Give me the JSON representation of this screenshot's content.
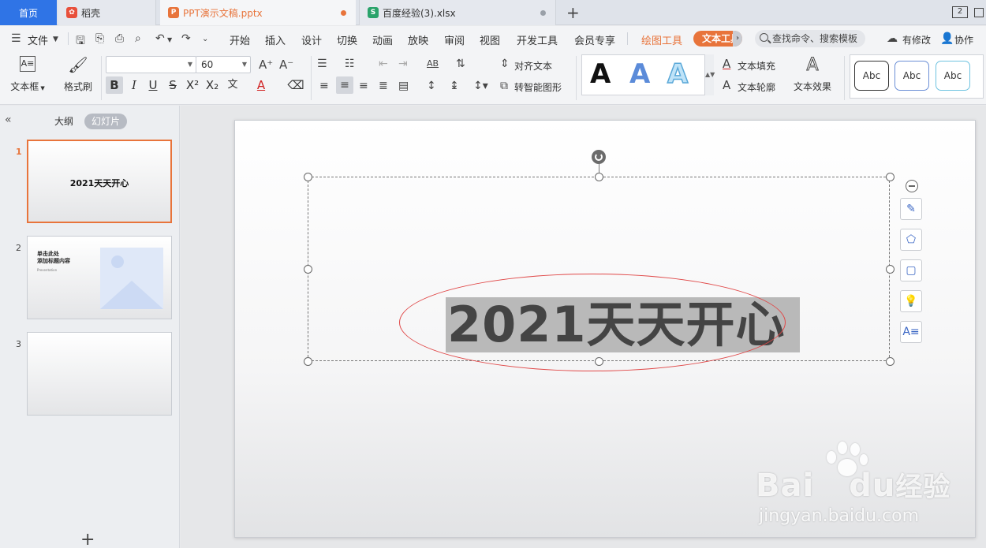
{
  "colors": {
    "accent": "#e8743b",
    "home_tab": "#2f74e6",
    "selection": "#b9b9b9",
    "ellipse": "#e04848"
  },
  "tabs": {
    "home": "首页",
    "daoke": "稻壳",
    "ppt": "PPT演示文稿.pptx",
    "xls": "百度经验(3).xlsx",
    "window_count": "2"
  },
  "menu": {
    "file": "文件",
    "items": [
      "开始",
      "插入",
      "设计",
      "切换",
      "动画",
      "放映",
      "审阅",
      "视图",
      "开发工具",
      "会员专享"
    ],
    "draw_tool": "绘图工具",
    "text_tool": "文本工具",
    "search_placeholder": "查找命令、搜索模板",
    "has_changes": "有修改",
    "collab": "协作"
  },
  "ribbon": {
    "textbox": "文本框",
    "format_painter": "格式刷",
    "font_name": "",
    "font_size": "60",
    "align_text": "对齐文本",
    "smart_shape": "转智能图形",
    "text_fill": "文本填充",
    "text_outline": "文本轮廓",
    "text_effect": "文本效果",
    "wordart_letter": "A",
    "style_labels": [
      "Abc",
      "Abc",
      "Abc"
    ]
  },
  "panel": {
    "outline_tab": "大纲",
    "slides_tab": "幻灯片",
    "slides": [
      {
        "num": "1",
        "title": "2021天天开心"
      },
      {
        "num": "2",
        "title_line1": "单击此处",
        "title_line2": "添加标题内容",
        "sub": "Presentation"
      },
      {
        "num": "3"
      }
    ]
  },
  "canvas": {
    "main_text": "2021天天开心"
  },
  "watermark": {
    "brand": "Bai",
    "brand2": "du",
    "brand_cn": "经验",
    "url": "jingyan.baidu.com"
  }
}
